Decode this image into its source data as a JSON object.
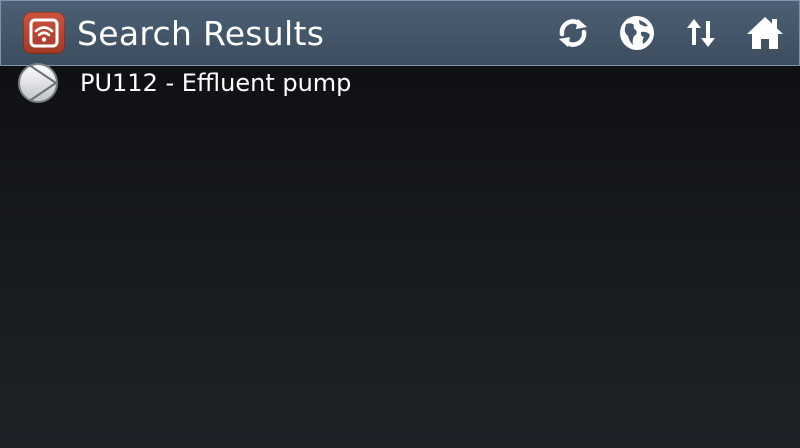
{
  "header": {
    "title": "Search Results",
    "logo_icon": "wifi-app-logo-icon",
    "actions": [
      {
        "name": "refresh",
        "icon": "refresh-icon"
      },
      {
        "name": "globe",
        "icon": "globe-icon"
      },
      {
        "name": "sort",
        "icon": "sort-arrows-icon"
      },
      {
        "name": "home",
        "icon": "home-icon"
      }
    ]
  },
  "results": [
    {
      "label": "PU112 - Effluent pump",
      "icon": "pump-icon"
    }
  ],
  "colors": {
    "header_bg": "#45576a",
    "header_border": "#7e94ab",
    "logo_bg": "#b54631",
    "background": "#15181c",
    "text": "#ffffff"
  }
}
